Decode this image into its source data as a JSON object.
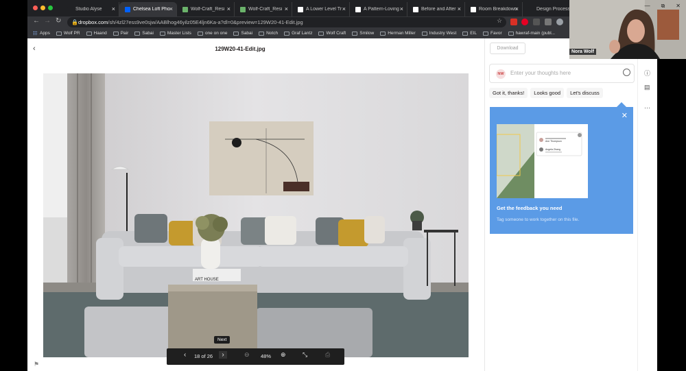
{
  "browser": {
    "tabs": [
      {
        "title": "Studio Alyse",
        "fav_color": "#202124",
        "active": false
      },
      {
        "title": "Chelsea Loft Pho",
        "fav_color": "#0061fe",
        "active": true
      },
      {
        "title": "Wolf-Craft_Resi",
        "fav_color": "#6bb36b",
        "active": false
      },
      {
        "title": "Wolf-Craft_Resi",
        "fav_color": "#6bb36b",
        "active": false
      },
      {
        "title": "A Lower Level Tr",
        "fav_color": "#ffffff",
        "active": false
      },
      {
        "title": "A Pattern-Loving",
        "fav_color": "#ffffff",
        "active": false
      },
      {
        "title": "Before and After",
        "fav_color": "#ffffff",
        "active": false
      },
      {
        "title": "Room Breakdown",
        "fav_color": "#ffffff",
        "active": false
      },
      {
        "title": "Design Process",
        "fav_color": "#202124",
        "active": false
      }
    ],
    "url_host": "dropbox.com",
    "url_path": "/sh/4zl27ess9ve0sjw/AABlhog46yilz05E4ljn6Ka-a?dl=0&preview=129W20-41-Edit.jpg",
    "bookmarks": [
      "Apps",
      "Wolf PR",
      "Haand",
      "Pair",
      "Sabai",
      "Master Lists",
      "one on one",
      "Sabai",
      "Notch",
      "Graf Lantz",
      "Wolf Craft",
      "Smilow",
      "Herman Miller",
      "Industry West",
      "EIL",
      "Favor",
      "hawraf-main (publ..."
    ]
  },
  "viewer": {
    "filename": "129W20-41-Edit.jpg",
    "page_indicator": "18 of 26",
    "page_current": 18,
    "page_total": 26,
    "zoom": "48%",
    "tooltip": "Next",
    "book_title": "ART HOUSE"
  },
  "sidebar": {
    "download_label": "Download",
    "avatar_initials": "NW",
    "comment_placeholder": "Enter your thoughts here",
    "quick_replies": [
      "Got it, thanks!",
      "Looks good",
      "Let's discuss"
    ],
    "promo": {
      "title": "Get the feedback you need",
      "subtitle": "Tag someone to work together on this file.",
      "mock_names": [
        "Ann Thompson",
        "Angela Zhang"
      ]
    }
  },
  "webcam": {
    "name": "Nora Wolf"
  },
  "colors": {
    "dropbox_blue": "#5b9be6",
    "chrome_dark": "#202124",
    "chrome_mid": "#35363a"
  }
}
